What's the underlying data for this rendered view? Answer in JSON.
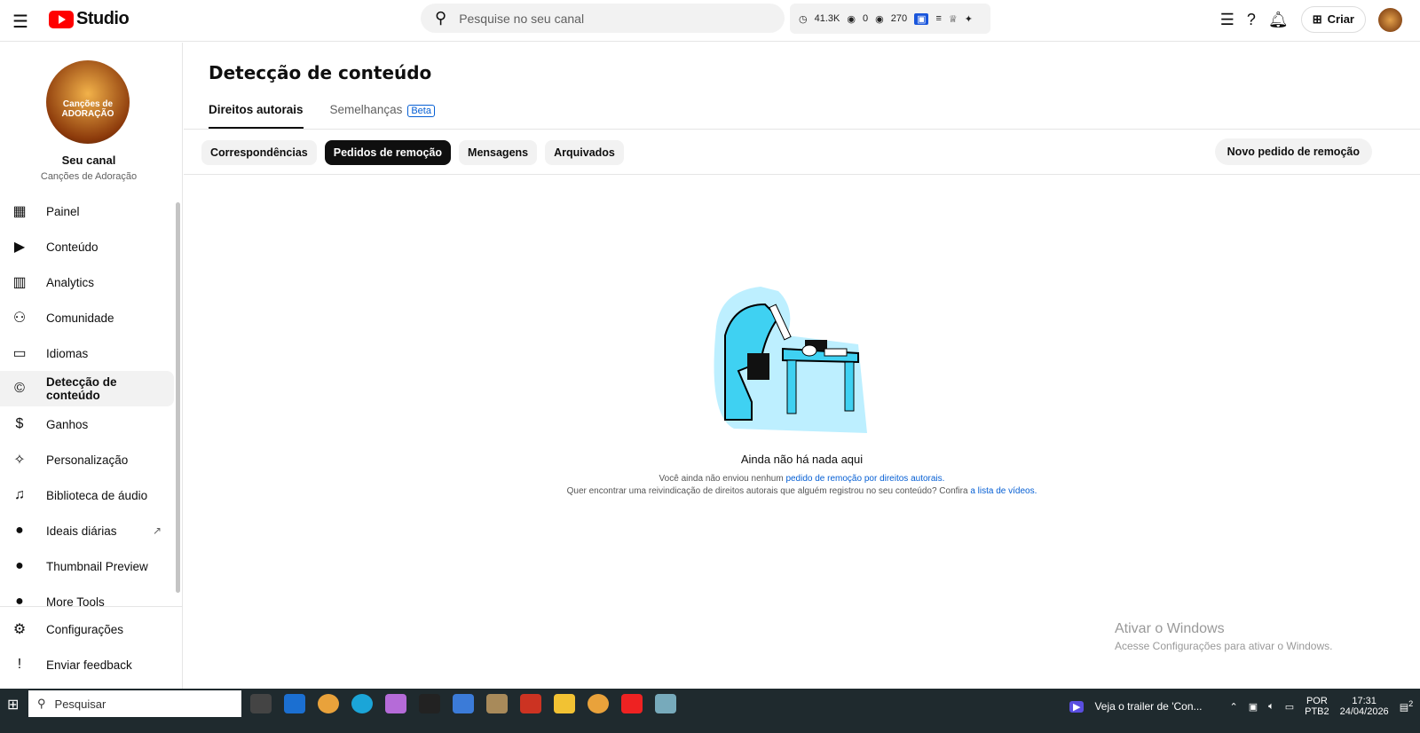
{
  "header": {
    "brand": "Studio",
    "search_placeholder": "Pesquise no seu canal",
    "stats": {
      "watch": "41.3K",
      "views_a": "0",
      "views_b": "270"
    },
    "create_label": "Criar"
  },
  "channel": {
    "avatar_text": "Canções de ADORAÇÃO",
    "title": "Seu canal",
    "name": "Canções de Adoração"
  },
  "sidebar": {
    "items": [
      {
        "label": "Painel",
        "icon": "▦"
      },
      {
        "label": "Conteúdo",
        "icon": "▶"
      },
      {
        "label": "Analytics",
        "icon": "▥"
      },
      {
        "label": "Comunidade",
        "icon": "⚇"
      },
      {
        "label": "Idiomas",
        "icon": "▭"
      },
      {
        "label": "Detecção de conteúdo",
        "icon": "©"
      },
      {
        "label": "Ganhos",
        "icon": "$"
      },
      {
        "label": "Personalização",
        "icon": "✧"
      },
      {
        "label": "Biblioteca de áudio",
        "icon": "♫"
      },
      {
        "label": "Ideais diárias",
        "icon": "●"
      },
      {
        "label": "Thumbnail Preview",
        "icon": "●"
      },
      {
        "label": "More Tools",
        "icon": "●"
      }
    ],
    "bottom": [
      {
        "label": "Configurações",
        "icon": "⚙"
      },
      {
        "label": "Enviar feedback",
        "icon": "!"
      }
    ]
  },
  "page": {
    "title": "Detecção de conteúdo",
    "tabs": [
      "Direitos autorais",
      "Semelhanças"
    ],
    "beta": "Beta",
    "chips": [
      "Correspondências",
      "Pedidos de remoção",
      "Mensagens",
      "Arquivados"
    ],
    "new_button": "Novo pedido de remoção",
    "empty": {
      "title": "Ainda não há nada aqui",
      "line1": "Você ainda não enviou nenhum ",
      "link1": "pedido de remoção por direitos autorais.",
      "line2": "Quer encontrar uma reivindicação de direitos autorais que alguém registrou no seu conteúdo? Confira ",
      "link2": "a lista de vídeos."
    }
  },
  "watermark": {
    "title": "Ativar o Windows",
    "sub": "Acesse Configurações para ativar o Windows."
  },
  "taskbar": {
    "search": "Pesquisar",
    "news": "Veja o trailer de 'Con...",
    "lang": "POR",
    "layout": "PTB2",
    "time": "17:31",
    "date": "24/04/2026",
    "notif": "2"
  }
}
